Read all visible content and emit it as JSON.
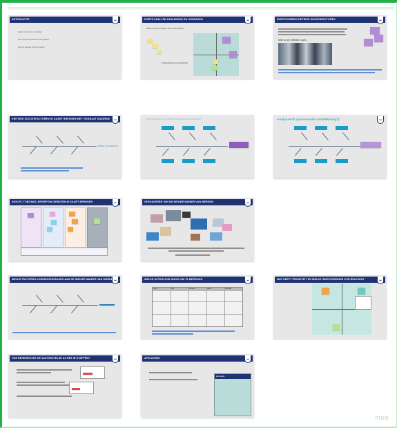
{
  "board": {
    "watermark": "miro",
    "accent_color": "#21b14a",
    "slide_title_color": "#1f3274"
  },
  "slides": [
    {
      "title": "INTRODUCTIE",
      "lines": [
        "Sector en orde in uw geheel",
        "Hoe zou je vertrekken in een geheel",
        "Het zijn eerstes van uw nieuwe"
      ]
    },
    {
      "title": "KORTE ANALYSE AANLEIDING EN OORZAKEN",
      "subtitle": "Wat is uw eigen analyse van de aanleiding?",
      "note_label": "OORZAKEN EN AANLEIDING"
    },
    {
      "title": "IDENTIFICEREN KRITIEKE SUCCESFACTOREN",
      "photo_caption": "Wat is de kritieke onze..."
    },
    {
      "title": "KRITIEKE SUCCESFACTOREN IN KAART BRENGEN MET VISGRAAT DIAGRAM",
      "end_label": "Kritieke succesfactoren"
    },
    {
      "title": "",
      "intro": "Welke factoren houden verband met de kritieke succesfactoren?"
    },
    {
      "title": "Analyseerd! (succesvolle ontwikkeling?)"
    },
    {
      "title": "INZICHT, TOEGANG, BEGRIP EN DIENSTEN IN KAART BRENGEN"
    },
    {
      "title": "VERGADEREN VAN DE NIEUWE MANIER VAN WERKEN"
    },
    {
      "title": "WELKE FACTOREN KUNNEN BIJDRAGEN AAN DE NIEUWE MANIER VAN WERKEN"
    },
    {
      "title": "WELKE ACTIES ZIJN NODIG OM TE BEREIKEN",
      "table_headers": [
        "Actie",
        "Wie",
        "Wanneer",
        "Status",
        "Resultaat"
      ]
    },
    {
      "title": "WAT HEEFT PRIORITEIT EN WELKE INVESTERINGEN ZIJN RELEVANT"
    },
    {
      "title": "HOE BEREIKEN WE DE VASTGESTELDE ACTIES IN STAPPEN?"
    },
    {
      "title": "AFSLUITING",
      "panel_heading": "Evaluatie"
    }
  ]
}
